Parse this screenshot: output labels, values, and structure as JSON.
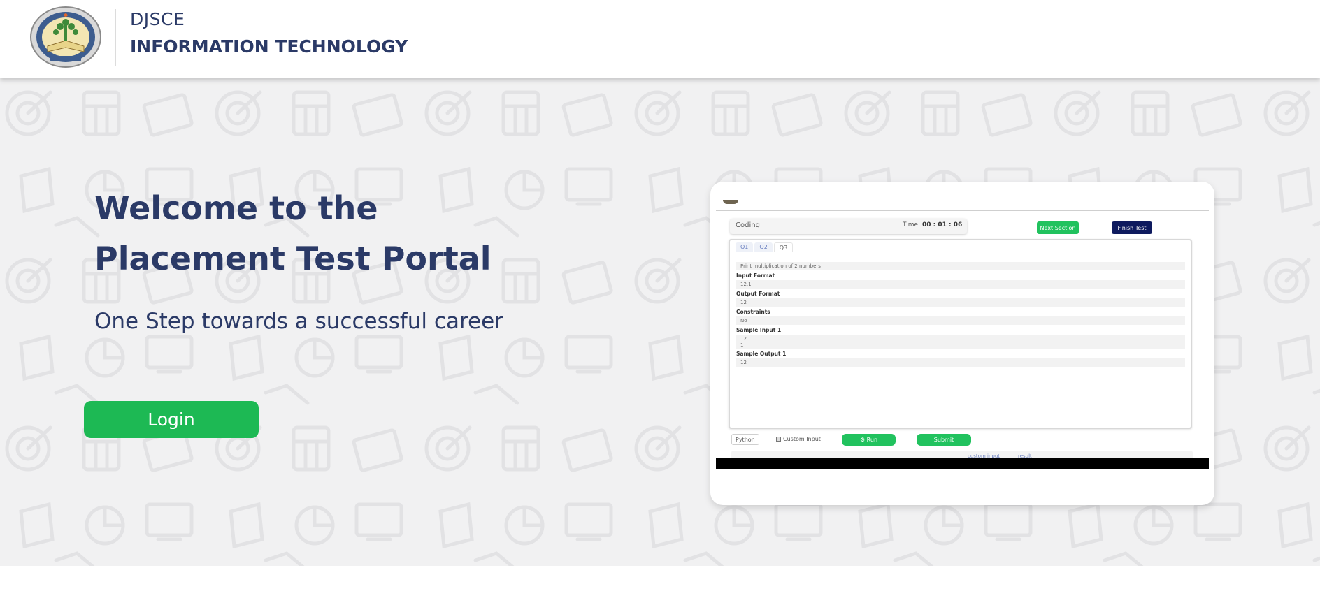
{
  "header": {
    "brand_top": "DJSCE",
    "brand_bottom": "INFORMATION TECHNOLOGY",
    "logo_icon": "college-emblem"
  },
  "hero": {
    "title_line1": "Welcome to the",
    "title_line2": "Placement Test Portal",
    "subtitle": "One Step towards a successful career",
    "login_label": "Login"
  },
  "preview": {
    "section": "Coding",
    "time_label": "Time:",
    "time_value": "00 : 01 : 06",
    "next_section_label": "Next Section",
    "finish_test_label": "Finish Test",
    "tabs": [
      "Q1",
      "Q2",
      "Q3"
    ],
    "question": "Print multiplication of 2 numbers",
    "input_format_label": "Input Format",
    "input_format_value": "12,1",
    "output_format_label": "Output Format",
    "output_format_value": "12",
    "constraints_label": "Constraints",
    "constraints_value": "No",
    "sample_input_label": "Sample Input 1",
    "sample_input_line1": "12",
    "sample_input_line2": "1",
    "sample_output_label": "Sample Output 1",
    "sample_output_value": "12",
    "language": "Python",
    "custom_input_label": "Custom Input",
    "run_label": "⚙ Run",
    "submit_label": "Submit",
    "strip_tab_custom": "custom input",
    "strip_tab_result": "result"
  },
  "colors": {
    "brand_text": "#2b3a67",
    "login_green": "#1db954",
    "finish_navy": "#0e1a5e",
    "hero_bg": "#f1f1f2"
  }
}
